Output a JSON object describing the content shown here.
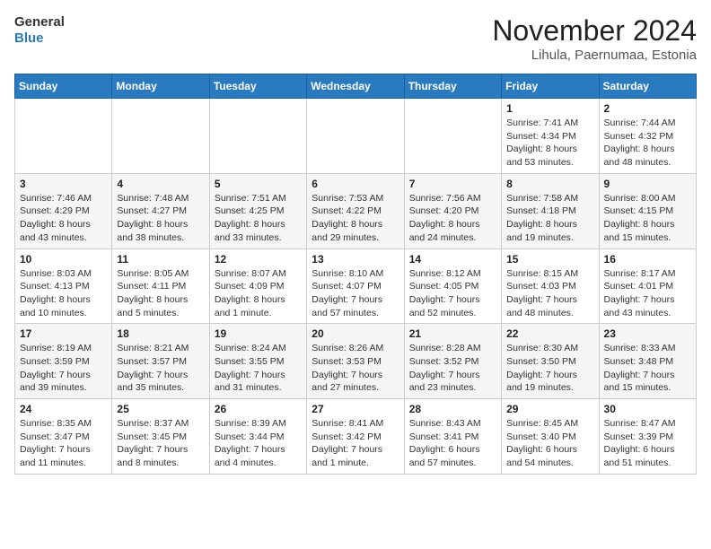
{
  "header": {
    "logo_line1": "General",
    "logo_line2": "Blue",
    "month_title": "November 2024",
    "location": "Lihula, Paernumaa, Estonia"
  },
  "weekdays": [
    "Sunday",
    "Monday",
    "Tuesday",
    "Wednesday",
    "Thursday",
    "Friday",
    "Saturday"
  ],
  "weeks": [
    [
      {
        "day": "",
        "info": ""
      },
      {
        "day": "",
        "info": ""
      },
      {
        "day": "",
        "info": ""
      },
      {
        "day": "",
        "info": ""
      },
      {
        "day": "",
        "info": ""
      },
      {
        "day": "1",
        "info": "Sunrise: 7:41 AM\nSunset: 4:34 PM\nDaylight: 8 hours and 53 minutes."
      },
      {
        "day": "2",
        "info": "Sunrise: 7:44 AM\nSunset: 4:32 PM\nDaylight: 8 hours and 48 minutes."
      }
    ],
    [
      {
        "day": "3",
        "info": "Sunrise: 7:46 AM\nSunset: 4:29 PM\nDaylight: 8 hours and 43 minutes."
      },
      {
        "day": "4",
        "info": "Sunrise: 7:48 AM\nSunset: 4:27 PM\nDaylight: 8 hours and 38 minutes."
      },
      {
        "day": "5",
        "info": "Sunrise: 7:51 AM\nSunset: 4:25 PM\nDaylight: 8 hours and 33 minutes."
      },
      {
        "day": "6",
        "info": "Sunrise: 7:53 AM\nSunset: 4:22 PM\nDaylight: 8 hours and 29 minutes."
      },
      {
        "day": "7",
        "info": "Sunrise: 7:56 AM\nSunset: 4:20 PM\nDaylight: 8 hours and 24 minutes."
      },
      {
        "day": "8",
        "info": "Sunrise: 7:58 AM\nSunset: 4:18 PM\nDaylight: 8 hours and 19 minutes."
      },
      {
        "day": "9",
        "info": "Sunrise: 8:00 AM\nSunset: 4:15 PM\nDaylight: 8 hours and 15 minutes."
      }
    ],
    [
      {
        "day": "10",
        "info": "Sunrise: 8:03 AM\nSunset: 4:13 PM\nDaylight: 8 hours and 10 minutes."
      },
      {
        "day": "11",
        "info": "Sunrise: 8:05 AM\nSunset: 4:11 PM\nDaylight: 8 hours and 5 minutes."
      },
      {
        "day": "12",
        "info": "Sunrise: 8:07 AM\nSunset: 4:09 PM\nDaylight: 8 hours and 1 minute."
      },
      {
        "day": "13",
        "info": "Sunrise: 8:10 AM\nSunset: 4:07 PM\nDaylight: 7 hours and 57 minutes."
      },
      {
        "day": "14",
        "info": "Sunrise: 8:12 AM\nSunset: 4:05 PM\nDaylight: 7 hours and 52 minutes."
      },
      {
        "day": "15",
        "info": "Sunrise: 8:15 AM\nSunset: 4:03 PM\nDaylight: 7 hours and 48 minutes."
      },
      {
        "day": "16",
        "info": "Sunrise: 8:17 AM\nSunset: 4:01 PM\nDaylight: 7 hours and 43 minutes."
      }
    ],
    [
      {
        "day": "17",
        "info": "Sunrise: 8:19 AM\nSunset: 3:59 PM\nDaylight: 7 hours and 39 minutes."
      },
      {
        "day": "18",
        "info": "Sunrise: 8:21 AM\nSunset: 3:57 PM\nDaylight: 7 hours and 35 minutes."
      },
      {
        "day": "19",
        "info": "Sunrise: 8:24 AM\nSunset: 3:55 PM\nDaylight: 7 hours and 31 minutes."
      },
      {
        "day": "20",
        "info": "Sunrise: 8:26 AM\nSunset: 3:53 PM\nDaylight: 7 hours and 27 minutes."
      },
      {
        "day": "21",
        "info": "Sunrise: 8:28 AM\nSunset: 3:52 PM\nDaylight: 7 hours and 23 minutes."
      },
      {
        "day": "22",
        "info": "Sunrise: 8:30 AM\nSunset: 3:50 PM\nDaylight: 7 hours and 19 minutes."
      },
      {
        "day": "23",
        "info": "Sunrise: 8:33 AM\nSunset: 3:48 PM\nDaylight: 7 hours and 15 minutes."
      }
    ],
    [
      {
        "day": "24",
        "info": "Sunrise: 8:35 AM\nSunset: 3:47 PM\nDaylight: 7 hours and 11 minutes."
      },
      {
        "day": "25",
        "info": "Sunrise: 8:37 AM\nSunset: 3:45 PM\nDaylight: 7 hours and 8 minutes."
      },
      {
        "day": "26",
        "info": "Sunrise: 8:39 AM\nSunset: 3:44 PM\nDaylight: 7 hours and 4 minutes."
      },
      {
        "day": "27",
        "info": "Sunrise: 8:41 AM\nSunset: 3:42 PM\nDaylight: 7 hours and 1 minute."
      },
      {
        "day": "28",
        "info": "Sunrise: 8:43 AM\nSunset: 3:41 PM\nDaylight: 6 hours and 57 minutes."
      },
      {
        "day": "29",
        "info": "Sunrise: 8:45 AM\nSunset: 3:40 PM\nDaylight: 6 hours and 54 minutes."
      },
      {
        "day": "30",
        "info": "Sunrise: 8:47 AM\nSunset: 3:39 PM\nDaylight: 6 hours and 51 minutes."
      }
    ]
  ]
}
